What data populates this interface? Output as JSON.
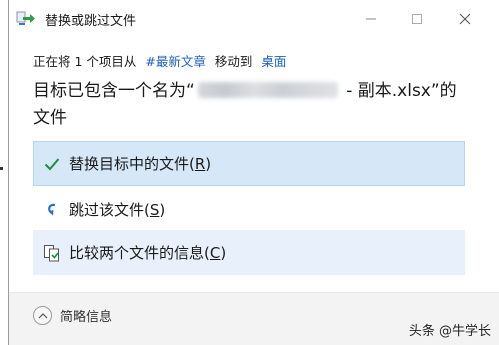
{
  "window": {
    "title": "替换或跳过文件",
    "controls": {
      "minimize": "—",
      "maximize": "☐",
      "close": "✕"
    }
  },
  "info": {
    "prefix": "正在将 1 个项目从",
    "source": "#最新文章",
    "middle": "移动到",
    "destination": "桌面"
  },
  "message": {
    "before": "目标已包含一个名为“",
    "after": " - 副本.xlsx”的文件"
  },
  "options": [
    {
      "label": "替换目标中的文件(",
      "key": "R",
      "close": ")",
      "icon": "check-icon"
    },
    {
      "label": "跳过该文件(",
      "key": "S",
      "close": ")",
      "icon": "skip-arrow-icon"
    },
    {
      "label": "比较两个文件的信息(",
      "key": "C",
      "close": ")",
      "icon": "compare-files-icon"
    }
  ],
  "footer": {
    "details_label": "简略信息",
    "watermark": "头条 @牛学长"
  },
  "colors": {
    "selected_bg": "#d6e7f8",
    "hover_bg": "#e8f1fb",
    "link": "#1e5fb4",
    "check": "#1a8f3c"
  }
}
